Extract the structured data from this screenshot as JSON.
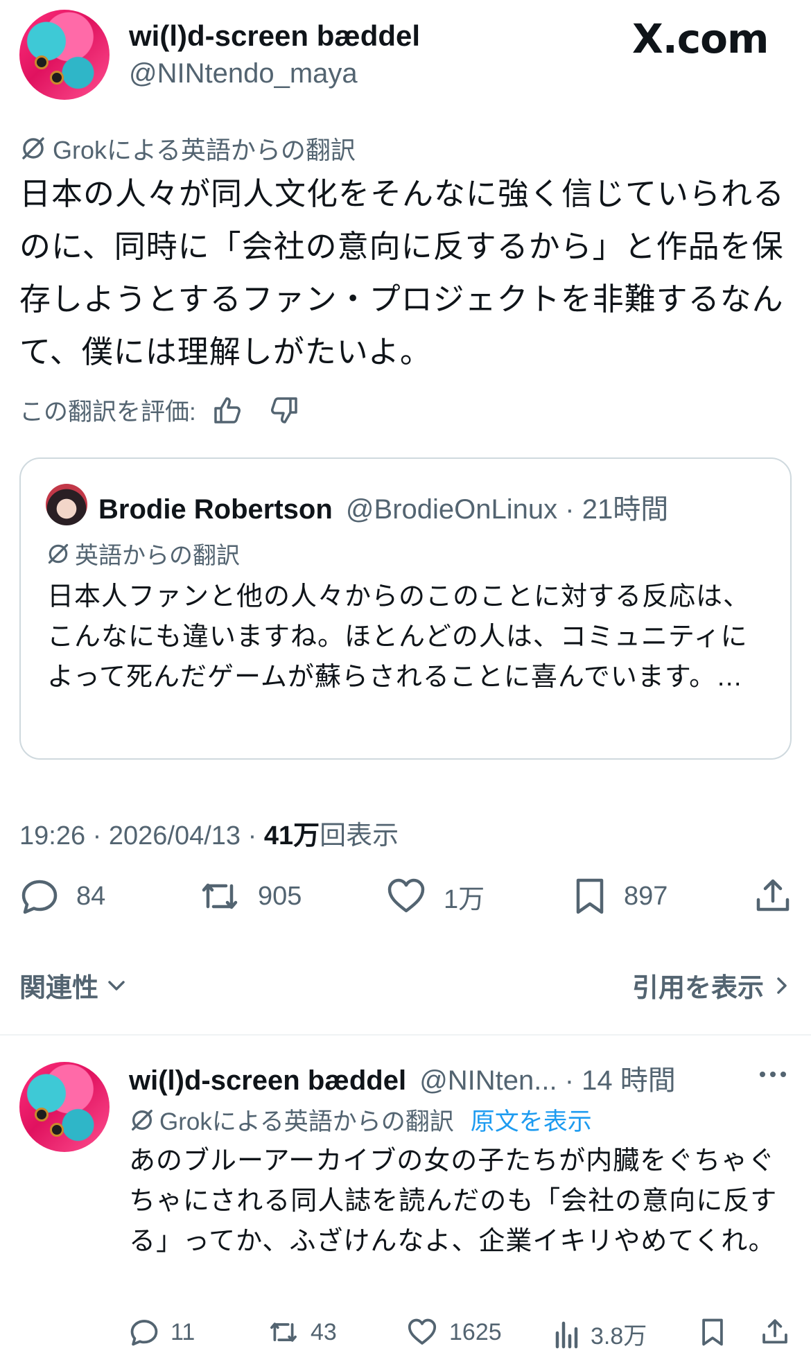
{
  "header": {
    "display_name": "wi(l)d-screen bæddel",
    "handle": "@NINtendo_maya",
    "brand": "X.com"
  },
  "main_post": {
    "translation_label": "Grokによる英語からの翻訳",
    "text": "日本の人々が同人文化をそんなに強く信じていられるのに、同時に「会社の意向に反するから」と作品を保存しようとするファン・プロジェクトを非難するなんて、僕には理解しがたいよ。",
    "rate_label": "この翻訳を評価:",
    "quote": {
      "display_name": "Brodie Robertson",
      "handle": "@BrodieOnLinux",
      "time": "· 21時間",
      "translation_label": "英語からの翻訳",
      "text": "日本人ファンと他の人々からのこのことに対する反応は、こんなにも違いますね。ほとんどの人は、コミュニティによって死んだゲームが蘇らされることに喜んでいます。…"
    },
    "meta_time": "19:26 · 2026/04/13 · ",
    "meta_views_count": "41万",
    "meta_views_label": "回表示",
    "stats": {
      "replies": "84",
      "reposts": "905",
      "likes": "1万",
      "bookmarks": "897"
    }
  },
  "sort": {
    "label": "関連性",
    "quotes_link": "引用を表示"
  },
  "reply": {
    "display_name": "wi(l)d-screen bæddel",
    "handle": "@NINten...",
    "time": "· 14 時間",
    "translation_label": "Grokによる英語からの翻訳",
    "show_original": "原文を表示",
    "text": "あのブルーアーカイブの女の子たちが内臓をぐちゃぐちゃにされる同人誌を読んだのも「会社の意向に反する」ってか、ふざけんなよ、企業イキリやめてくれ。",
    "stats": {
      "replies": "11",
      "reposts": "43",
      "likes": "1625",
      "views": "3.8万"
    }
  },
  "colors": {
    "accent": "#1d9bf0",
    "muted": "#536471",
    "text": "#0f1419"
  }
}
